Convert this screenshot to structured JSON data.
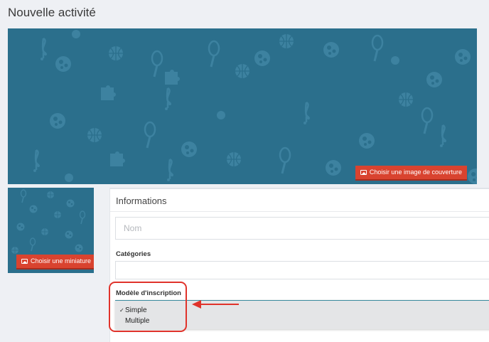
{
  "page": {
    "title": "Nouvelle activité"
  },
  "cover": {
    "button_label": "Choisir une image de couverture",
    "background_color": "#2b6f8c",
    "button_color": "#d9432f"
  },
  "thumbnail": {
    "button_label": "Choisir une miniature"
  },
  "info": {
    "title": "Informations",
    "name_placeholder": "Nom",
    "categories_label": "Catégories",
    "model_label": "Modèle d'inscription",
    "model_options": [
      {
        "label": "Simple",
        "selected": true,
        "check": "✓"
      },
      {
        "label": "Multiple",
        "selected": false,
        "check": ""
      }
    ]
  },
  "annotation": {
    "color": "#e0332b"
  }
}
